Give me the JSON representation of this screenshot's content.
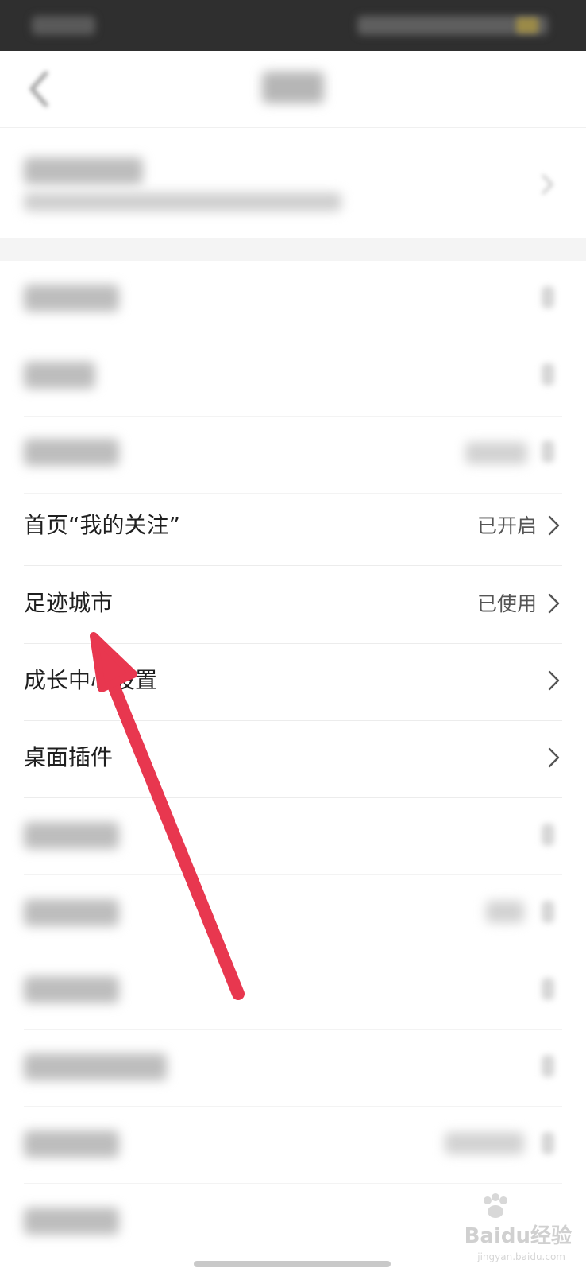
{
  "rows": [
    {
      "label": "首页“我的关注”",
      "value": "已开启"
    },
    {
      "label": "足迹城市",
      "value": "已使用"
    },
    {
      "label": "成长中心设置",
      "value": ""
    },
    {
      "label": "桌面插件",
      "value": ""
    }
  ],
  "watermark": {
    "brand": "Baidu经验",
    "url": "jingyan.baidu.com"
  },
  "colors": {
    "arrow": "#e8374f",
    "statusbar": "#2f2f2f",
    "text": "#1f1f1f",
    "secondary_text": "#555555"
  }
}
